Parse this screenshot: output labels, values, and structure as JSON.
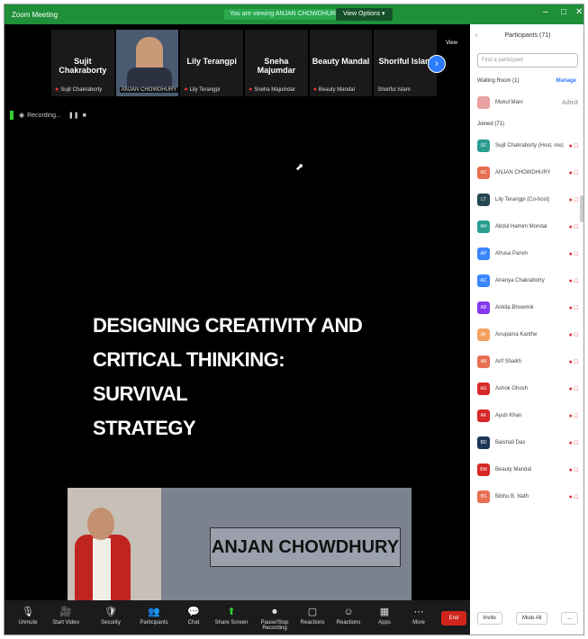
{
  "window": {
    "app_title": "Zoom Meeting",
    "banner": "You are viewing ANJAN CHOWDHURY's screen",
    "view_options": "View Options ▾"
  },
  "gallery": {
    "view_label": "View",
    "tiles": [
      {
        "name": "Sujit Chakraborty",
        "sub": "Sujit Chakraborty"
      },
      {
        "name": "",
        "sub": "ANJAN CHOWDHURY"
      },
      {
        "name": "Lily Terangpi",
        "sub": "Lily Terangpi"
      },
      {
        "name": "Sneha Majumdar",
        "sub": "Sneha Majumdar"
      },
      {
        "name": "Beauty Mandal",
        "sub": "Beauty Mandal"
      },
      {
        "name": "Shoriful Islam",
        "sub": "Shoriful Islam"
      }
    ]
  },
  "recording": {
    "label": "Recording..."
  },
  "slide": {
    "title_line1": "DESIGNING CREATIVITY AND",
    "title_line2": "CRITICAL THINKING: SURVIVAL",
    "title_line3": "STRATEGY",
    "presenter_name": "ANJAN CHOWDHURY"
  },
  "participants_panel": {
    "header": "Participants (71)",
    "search_placeholder": "Find a participant",
    "waiting_room": "Waiting Room (1)",
    "admit_label": "Manage",
    "waiting_person": "Mukul Mani",
    "waiting_status": "Admit",
    "joined": "Joined (71)",
    "rows": [
      {
        "initials": "SC",
        "name": "Sujit Chakraborty (Host, me)",
        "color": "#2a9d8f"
      },
      {
        "initials": "AC",
        "name": "ANJAN CHOWDHURY",
        "color": "#e76f51"
      },
      {
        "initials": "LT",
        "name": "Lily Terangpi (Co-host)",
        "color": "#264653"
      },
      {
        "initials": "AH",
        "name": "Abdul Hamim Mondal",
        "color": "#2a9d8f"
      },
      {
        "initials": "AP",
        "name": "Afrusa Parvin",
        "color": "#3a86ff"
      },
      {
        "initials": "AC",
        "name": "Ananya Chakraborty",
        "color": "#3a86ff"
      },
      {
        "initials": "AB",
        "name": "Ankita Bhowmik",
        "color": "#8338ec"
      },
      {
        "initials": "AF",
        "name": "Anupama Kanthe",
        "color": "#f4a261"
      },
      {
        "initials": "AB",
        "name": "Arif Shaikh",
        "color": "#e76f51"
      },
      {
        "initials": "AG",
        "name": "Ashok Ghosh",
        "color": "#d62828"
      },
      {
        "initials": "AK",
        "name": "Ayub Khan",
        "color": "#d62828"
      },
      {
        "initials": "BD",
        "name": "Baishali Das",
        "color": "#1d3557"
      },
      {
        "initials": "BM",
        "name": "Beauty Mandal",
        "color": "#d62828"
      },
      {
        "initials": "BS",
        "name": "Bibhu B. Nath",
        "color": "#e76f51"
      }
    ],
    "footer": [
      "Invite",
      "Mute All",
      "..."
    ]
  },
  "toolbar": {
    "items": [
      {
        "icon": "🎙",
        "label": "Unmute"
      },
      {
        "icon": "🎥",
        "label": "Start Video"
      },
      {
        "icon": "🛡",
        "label": "Security"
      },
      {
        "icon": "👥",
        "label": "Participants"
      },
      {
        "icon": "💬",
        "label": "Chat"
      },
      {
        "icon": "⬆",
        "label": "Share Screen"
      },
      {
        "icon": "⏺",
        "label": "Pause/Stop Recording"
      },
      {
        "icon": "▢",
        "label": "Reactions"
      },
      {
        "icon": "☺",
        "label": "Reactions"
      },
      {
        "icon": "▦",
        "label": "Apps"
      },
      {
        "icon": "⋯",
        "label": "More"
      }
    ],
    "end_label": "End"
  }
}
